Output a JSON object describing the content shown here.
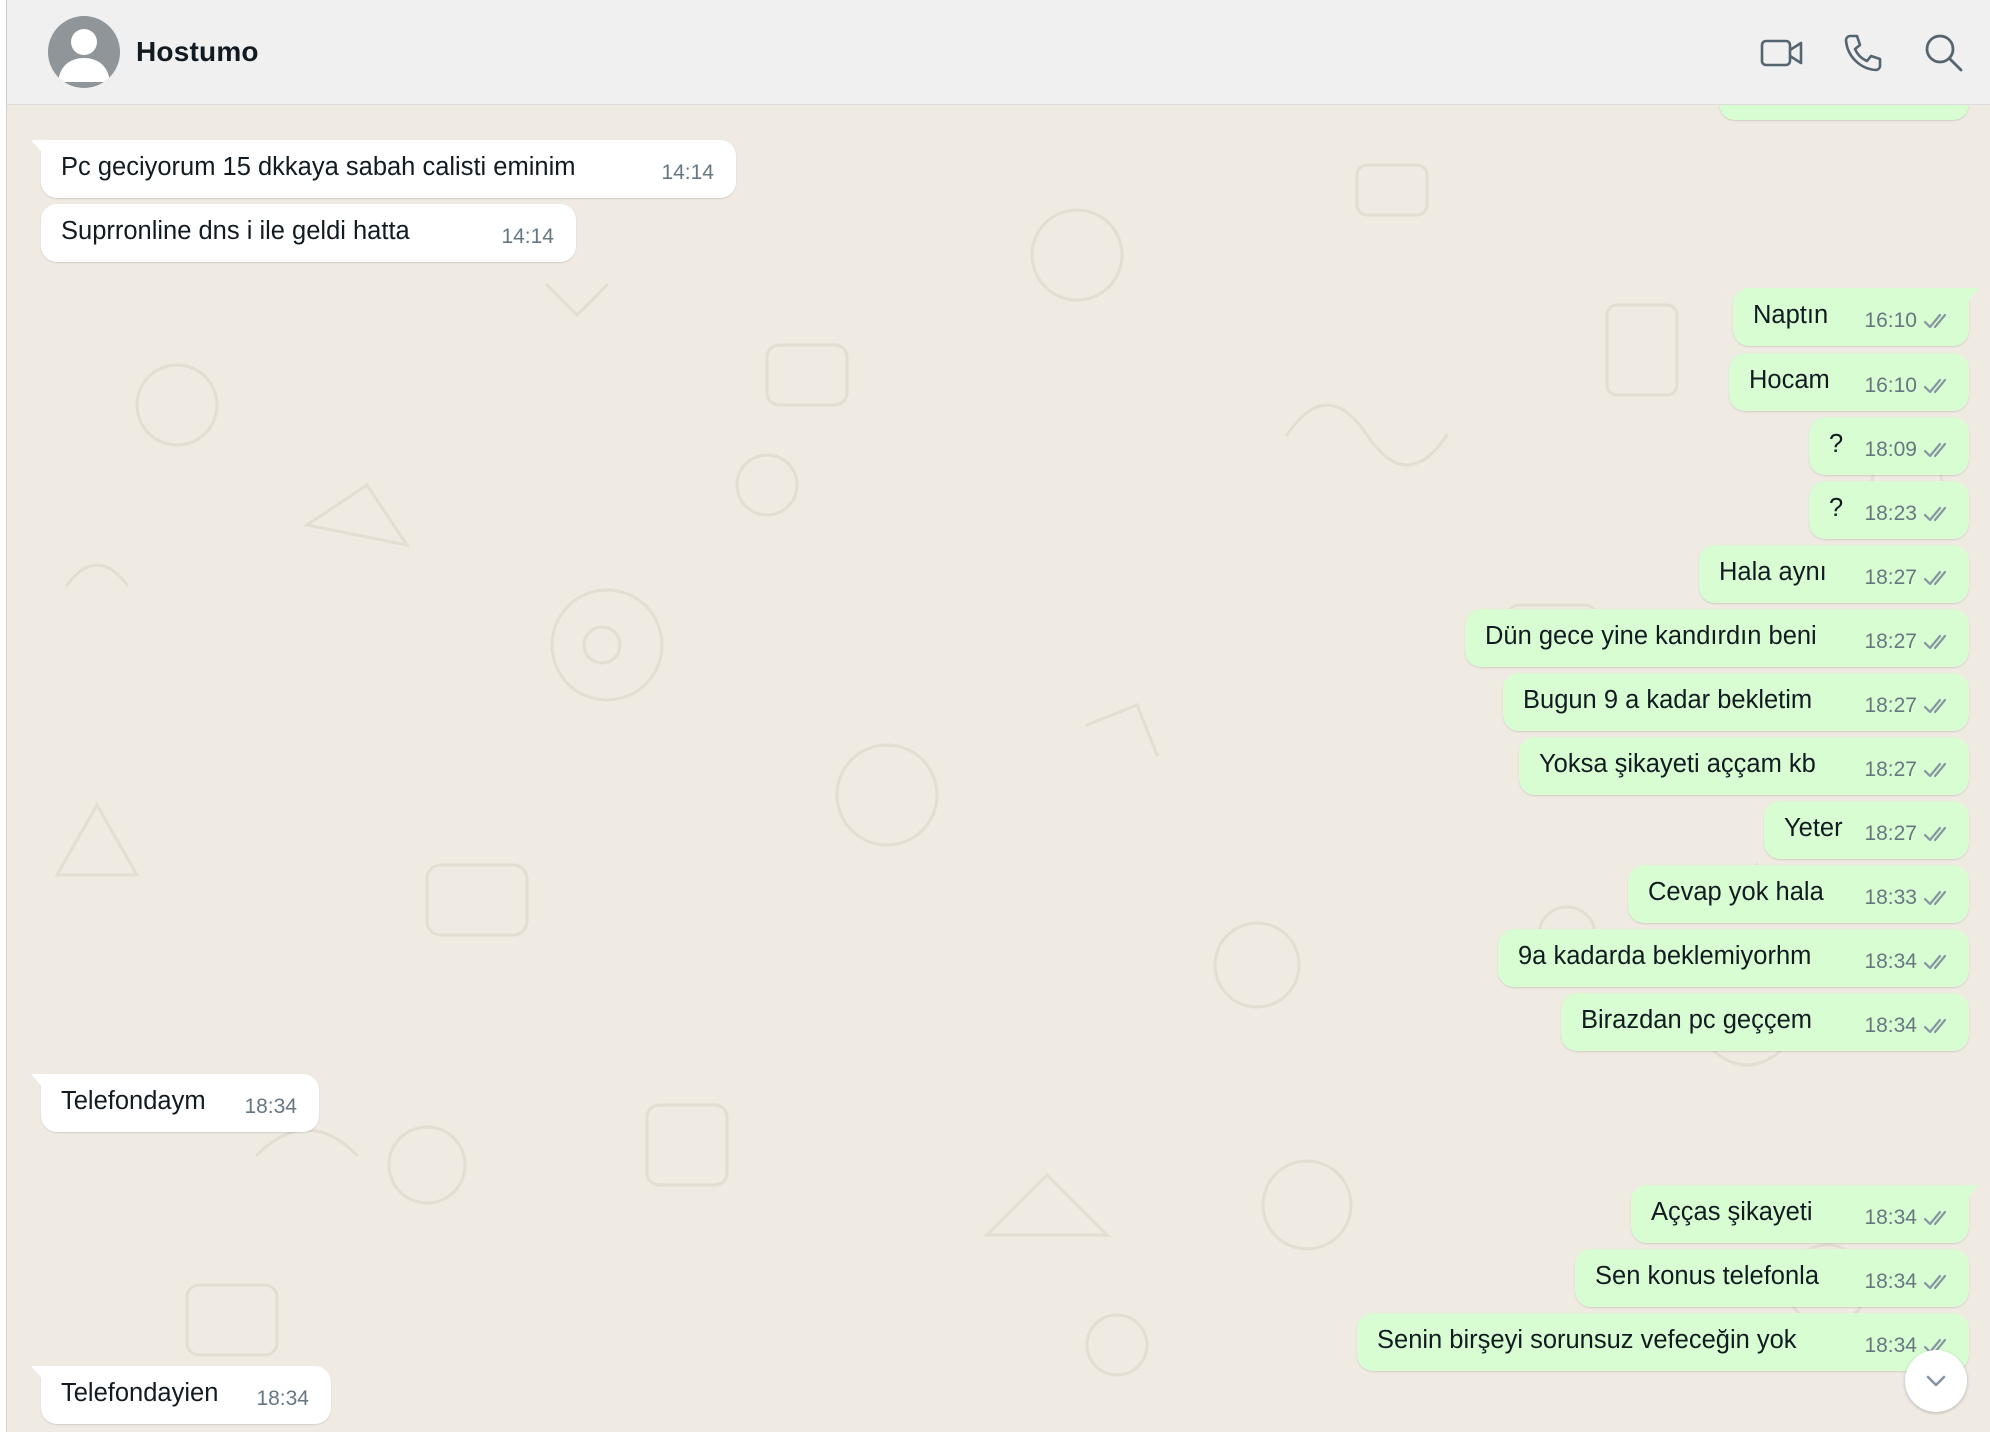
{
  "header": {
    "contact_name": "Hostumo",
    "icons": [
      "avatar-placeholder",
      "video-call-icon",
      "voice-call-icon",
      "search-icon"
    ]
  },
  "colors": {
    "background": "#efeae2",
    "header_bg": "#f0f0f0",
    "incoming_bubble": "#ffffff",
    "outgoing_bubble": "#d9fdd3",
    "timestamp": "#667781",
    "tick": "#8696a0"
  },
  "messages": [
    {
      "direction": "out",
      "text": "",
      "time": "",
      "status": "partially-visible"
    },
    {
      "direction": "in",
      "text": "Pc geciyorum 15 dkkaya sabah calisti eminim",
      "time": "14:14"
    },
    {
      "direction": "in",
      "text": "Suprronline dns i ile geldi hatta",
      "time": "14:14"
    },
    {
      "direction": "out",
      "text": "Naptın",
      "time": "16:10",
      "status": "read"
    },
    {
      "direction": "out",
      "text": "Hocam",
      "time": "16:10",
      "status": "read"
    },
    {
      "direction": "out",
      "text": "?",
      "time": "18:09",
      "status": "read"
    },
    {
      "direction": "out",
      "text": "?",
      "time": "18:23",
      "status": "read"
    },
    {
      "direction": "out",
      "text": "Hala aynı",
      "time": "18:27",
      "status": "read"
    },
    {
      "direction": "out",
      "text": "Dün gece yine kandırdın beni",
      "time": "18:27",
      "status": "read"
    },
    {
      "direction": "out",
      "text": "Bugun 9 a kadar bekletim",
      "time": "18:27",
      "status": "read"
    },
    {
      "direction": "out",
      "text": "Yoksa şikayeti aççam kb",
      "time": "18:27",
      "status": "read"
    },
    {
      "direction": "out",
      "text": "Yeter",
      "time": "18:27",
      "status": "read"
    },
    {
      "direction": "out",
      "text": "Cevap yok hala",
      "time": "18:33",
      "status": "read"
    },
    {
      "direction": "out",
      "text": "9a kadarda beklemiyorhm",
      "time": "18:34",
      "status": "read"
    },
    {
      "direction": "out",
      "text": "Birazdan pc geççem",
      "time": "18:34",
      "status": "read"
    },
    {
      "direction": "in",
      "text": "Telefondaym",
      "time": "18:34"
    },
    {
      "direction": "out",
      "text": "Açças şikayeti",
      "time": "18:34",
      "status": "read"
    },
    {
      "direction": "out",
      "text": "Sen konus telefonla",
      "time": "18:34",
      "status": "read"
    },
    {
      "direction": "out",
      "text": "Senin birşeyi sorunsuz vefeceğin yok",
      "time": "18:34",
      "status": "read"
    },
    {
      "direction": "in",
      "text": "Telefondayien",
      "time": "18:34"
    }
  ],
  "scroll_down_button": {
    "icon": "chevron-down-icon"
  }
}
